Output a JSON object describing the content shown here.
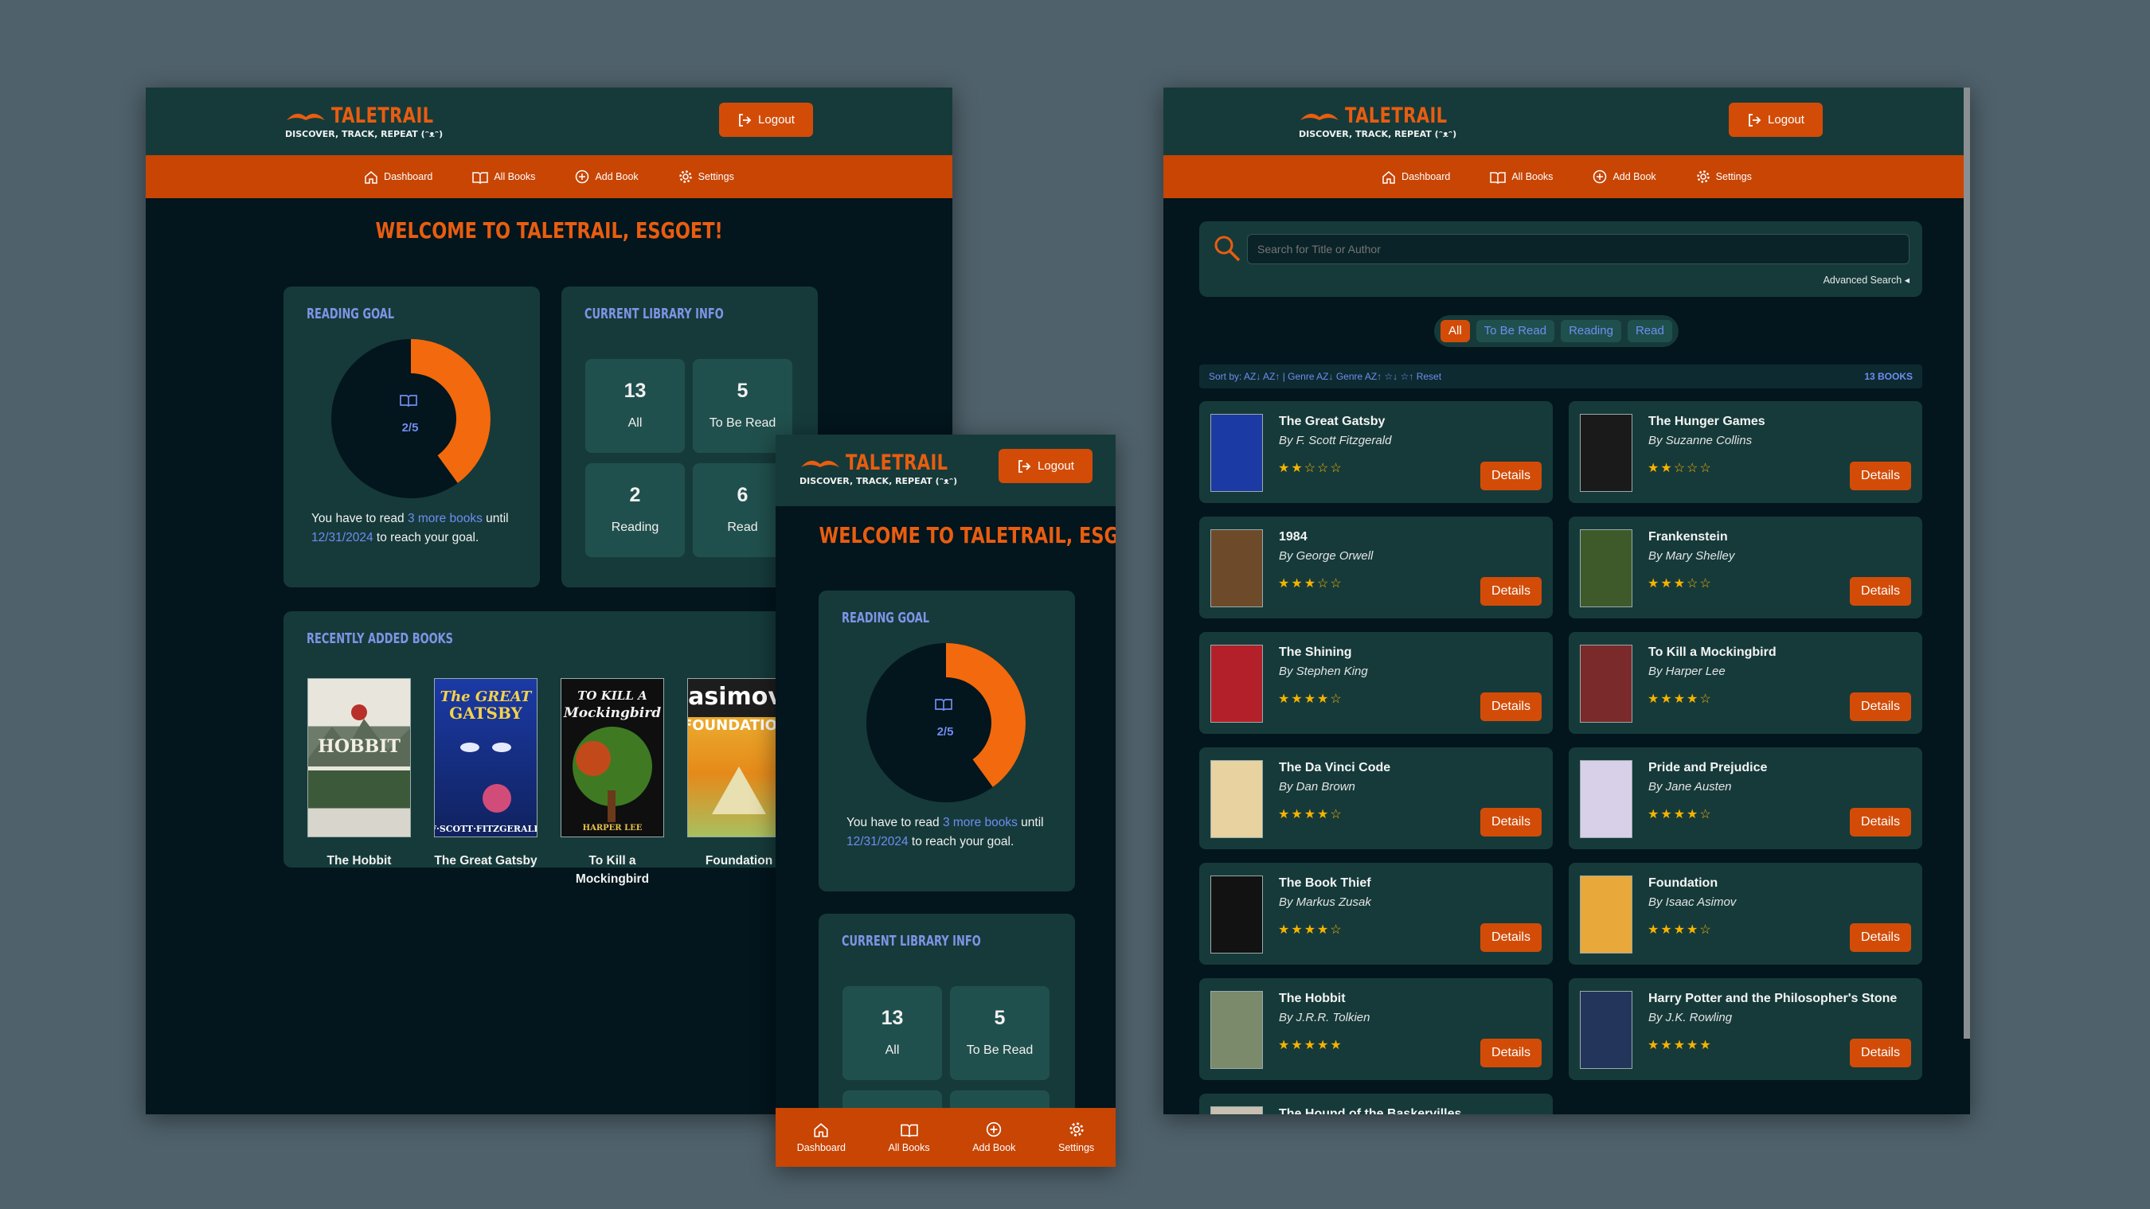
{
  "brand": {
    "name": "TALETRAIL",
    "tagline": "DISCOVER, TRACK, REPEAT (ᵔᴥᵔ)",
    "logout": "Logout"
  },
  "nav": [
    "Dashboard",
    "All Books",
    "Add Book",
    "Settings"
  ],
  "colors": {
    "accent": "#d24c08",
    "header": "#163a3a",
    "background": "#03151d",
    "link": "#6f8df0",
    "star": "#f5b300"
  },
  "dashboard": {
    "welcome": "WELCOME TO TALETRAIL, ESGOET!",
    "goal": {
      "title": "READING GOAL",
      "progress": "2/5",
      "read": 2,
      "target": 5,
      "text_pre": "You have to read ",
      "more": "3 more books",
      "text_mid": " until ",
      "date": "12/31/2024",
      "text_post": " to reach your goal."
    },
    "library": {
      "title": "CURRENT LIBRARY INFO",
      "stats": [
        {
          "n": "13",
          "label": "All"
        },
        {
          "n": "5",
          "label": "To Be Read"
        },
        {
          "n": "2",
          "label": "Reading"
        },
        {
          "n": "6",
          "label": "Read"
        }
      ]
    },
    "recent": {
      "title": "RECENTLY ADDED BOOKS",
      "books": [
        "The Hobbit",
        "The Great Gatsby",
        "To Kill a Mockingbird",
        "Foundation"
      ]
    }
  },
  "allbooks": {
    "search_placeholder": "Search for Title or Author",
    "advanced": "Advanced Search ◂",
    "filters": [
      "All",
      "To Be Read",
      "Reading",
      "Read"
    ],
    "sort": "Sort by: AZ↓ AZ↑ | Genre AZ↓ Genre AZ↑ ☆↓ ☆↑ Reset",
    "count": "13 BOOKS",
    "details": "Details",
    "books": [
      {
        "title": "The Great Gatsby",
        "author": "By F. Scott Fitzgerald",
        "stars": "★★☆☆☆"
      },
      {
        "title": "The Hunger Games",
        "author": "By Suzanne Collins",
        "stars": "★★☆☆☆"
      },
      {
        "title": "1984",
        "author": "By George Orwell",
        "stars": "★★★☆☆"
      },
      {
        "title": "Frankenstein",
        "author": "By Mary Shelley",
        "stars": "★★★☆☆"
      },
      {
        "title": "The Shining",
        "author": "By Stephen King",
        "stars": "★★★★☆"
      },
      {
        "title": "To Kill a Mockingbird",
        "author": "By Harper Lee",
        "stars": "★★★★☆"
      },
      {
        "title": "The Da Vinci Code",
        "author": "By Dan Brown",
        "stars": "★★★★☆"
      },
      {
        "title": "Pride and Prejudice",
        "author": "By Jane Austen",
        "stars": "★★★★☆"
      },
      {
        "title": "The Book Thief",
        "author": "By Markus Zusak",
        "stars": "★★★★☆"
      },
      {
        "title": "Foundation",
        "author": "By Isaac Asimov",
        "stars": "★★★★☆"
      },
      {
        "title": "The Hobbit",
        "author": "By J.R.R. Tolkien",
        "stars": "★★★★★"
      },
      {
        "title": "Harry Potter and the Philosopher's Stone",
        "author": "By J.K. Rowling",
        "stars": "★★★★★"
      },
      {
        "title": "The Hound of the Baskervilles",
        "author": "",
        "stars": ""
      }
    ]
  }
}
